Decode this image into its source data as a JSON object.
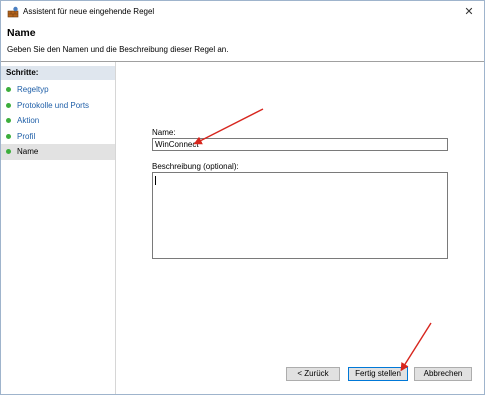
{
  "window": {
    "title": "Assistent für neue eingehende Regel",
    "close_glyph": "✕"
  },
  "header": {
    "title": "Name",
    "description": "Geben Sie den Namen und die Beschreibung dieser Regel an."
  },
  "sidebar": {
    "title": "Schritte:",
    "items": [
      {
        "label": "Regeltyp"
      },
      {
        "label": "Protokolle und Ports"
      },
      {
        "label": "Aktion"
      },
      {
        "label": "Profil"
      },
      {
        "label": "Name"
      }
    ],
    "active_index": 4
  },
  "form": {
    "name_label": "Name:",
    "name_value": "WinConnect",
    "description_label": "Beschreibung (optional):",
    "description_value": ""
  },
  "buttons": {
    "back": "< Zurück",
    "finish": "Fertig stellen",
    "cancel": "Abbrechen"
  },
  "colors": {
    "accent": "#0078d7",
    "link": "#1f5fa8",
    "step_dot": "#3cae3c",
    "arrow": "#d7261e"
  }
}
